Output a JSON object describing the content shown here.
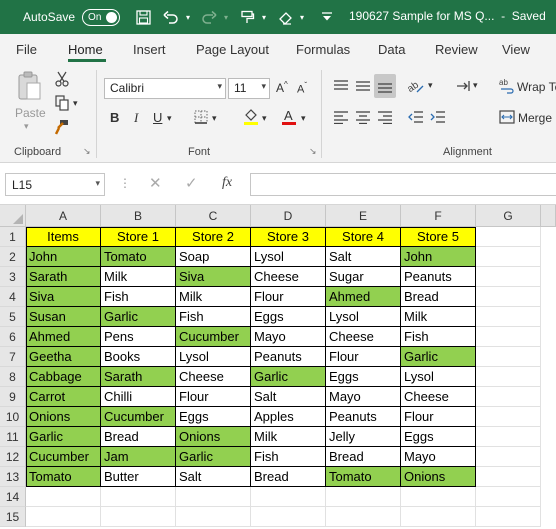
{
  "titlebar": {
    "autosave_label": "AutoSave",
    "autosave_state": "On",
    "document_title": "190627 Sample for MS Q...",
    "save_status": "Saved",
    "icons": [
      "save-icon",
      "undo-icon",
      "redo-icon",
      "format-painter-icon",
      "eraser-icon",
      "customize-dropdown-icon"
    ]
  },
  "ribbon_tabs": [
    "File",
    "Home",
    "Insert",
    "Page Layout",
    "Formulas",
    "Data",
    "Review",
    "View"
  ],
  "active_tab": "Home",
  "ribbon": {
    "clipboard": {
      "label": "Clipboard",
      "paste_label": "Paste"
    },
    "font": {
      "label": "Font",
      "font_name": "Calibri",
      "font_size": "11",
      "bold": "B",
      "italic": "I",
      "underline": "U"
    },
    "alignment": {
      "label": "Alignment",
      "wrap_text": "Wrap Te",
      "merge": "Merge"
    }
  },
  "formula_bar": {
    "name_box": "L15",
    "fx_label": "fx",
    "formula": ""
  },
  "sheet": {
    "columns": [
      "A",
      "B",
      "C",
      "D",
      "E",
      "F",
      "G"
    ],
    "rows": [
      "1",
      "2",
      "3",
      "4",
      "5",
      "6",
      "7",
      "8",
      "9",
      "10",
      "11",
      "12",
      "13",
      "14",
      "15"
    ],
    "header_fill": "#ffff00",
    "highlight_fill": "#92d050",
    "cells": [
      [
        {
          "v": "Items",
          "f": "Y"
        },
        {
          "v": "Store 1",
          "f": "Y"
        },
        {
          "v": "Store 2",
          "f": "Y"
        },
        {
          "v": "Store 3",
          "f": "Y"
        },
        {
          "v": "Store 4",
          "f": "Y"
        },
        {
          "v": "Store 5",
          "f": "Y"
        }
      ],
      [
        {
          "v": "John",
          "f": "G"
        },
        {
          "v": "Tomato",
          "f": "G"
        },
        {
          "v": "Soap"
        },
        {
          "v": "Lysol"
        },
        {
          "v": "Salt"
        },
        {
          "v": "John",
          "f": "G"
        }
      ],
      [
        {
          "v": "Sarath",
          "f": "G"
        },
        {
          "v": "Milk"
        },
        {
          "v": "Siva",
          "f": "G"
        },
        {
          "v": "Cheese"
        },
        {
          "v": "Sugar"
        },
        {
          "v": "Peanuts"
        }
      ],
      [
        {
          "v": "Siva",
          "f": "G"
        },
        {
          "v": "Fish"
        },
        {
          "v": "Milk"
        },
        {
          "v": "Flour"
        },
        {
          "v": "Ahmed",
          "f": "G"
        },
        {
          "v": "Bread"
        }
      ],
      [
        {
          "v": "Susan",
          "f": "G"
        },
        {
          "v": "Garlic",
          "f": "G"
        },
        {
          "v": "Fish"
        },
        {
          "v": "Eggs"
        },
        {
          "v": "Lysol"
        },
        {
          "v": "Milk"
        }
      ],
      [
        {
          "v": "Ahmed",
          "f": "G"
        },
        {
          "v": "Pens"
        },
        {
          "v": "Cucumber",
          "f": "G"
        },
        {
          "v": "Mayo"
        },
        {
          "v": "Cheese"
        },
        {
          "v": "Fish"
        }
      ],
      [
        {
          "v": "Geetha",
          "f": "G"
        },
        {
          "v": "Books"
        },
        {
          "v": "Lysol"
        },
        {
          "v": "Peanuts"
        },
        {
          "v": "Flour"
        },
        {
          "v": "Garlic",
          "f": "G"
        }
      ],
      [
        {
          "v": "Cabbage",
          "f": "G"
        },
        {
          "v": "Sarath",
          "f": "G"
        },
        {
          "v": "Cheese"
        },
        {
          "v": "Garlic",
          "f": "G"
        },
        {
          "v": "Eggs"
        },
        {
          "v": "Lysol"
        }
      ],
      [
        {
          "v": "Carrot",
          "f": "G"
        },
        {
          "v": "Chilli"
        },
        {
          "v": "Flour"
        },
        {
          "v": "Salt"
        },
        {
          "v": "Mayo"
        },
        {
          "v": "Cheese"
        }
      ],
      [
        {
          "v": "Onions",
          "f": "G"
        },
        {
          "v": "Cucumber",
          "f": "G"
        },
        {
          "v": "Eggs"
        },
        {
          "v": "Apples"
        },
        {
          "v": "Peanuts"
        },
        {
          "v": "Flour"
        }
      ],
      [
        {
          "v": "Garlic",
          "f": "G"
        },
        {
          "v": "Bread"
        },
        {
          "v": "Onions",
          "f": "G"
        },
        {
          "v": "Milk"
        },
        {
          "v": "Jelly"
        },
        {
          "v": "Eggs"
        }
      ],
      [
        {
          "v": "Cucumber",
          "f": "G"
        },
        {
          "v": "Jam",
          "f": "G"
        },
        {
          "v": "Garlic",
          "f": "G"
        },
        {
          "v": "Fish"
        },
        {
          "v": "Bread"
        },
        {
          "v": "Mayo"
        }
      ],
      [
        {
          "v": "Tomato",
          "f": "G"
        },
        {
          "v": "Butter"
        },
        {
          "v": "Salt"
        },
        {
          "v": "Bread"
        },
        {
          "v": "Tomato",
          "f": "G"
        },
        {
          "v": "Onions",
          "f": "G"
        }
      ]
    ]
  }
}
